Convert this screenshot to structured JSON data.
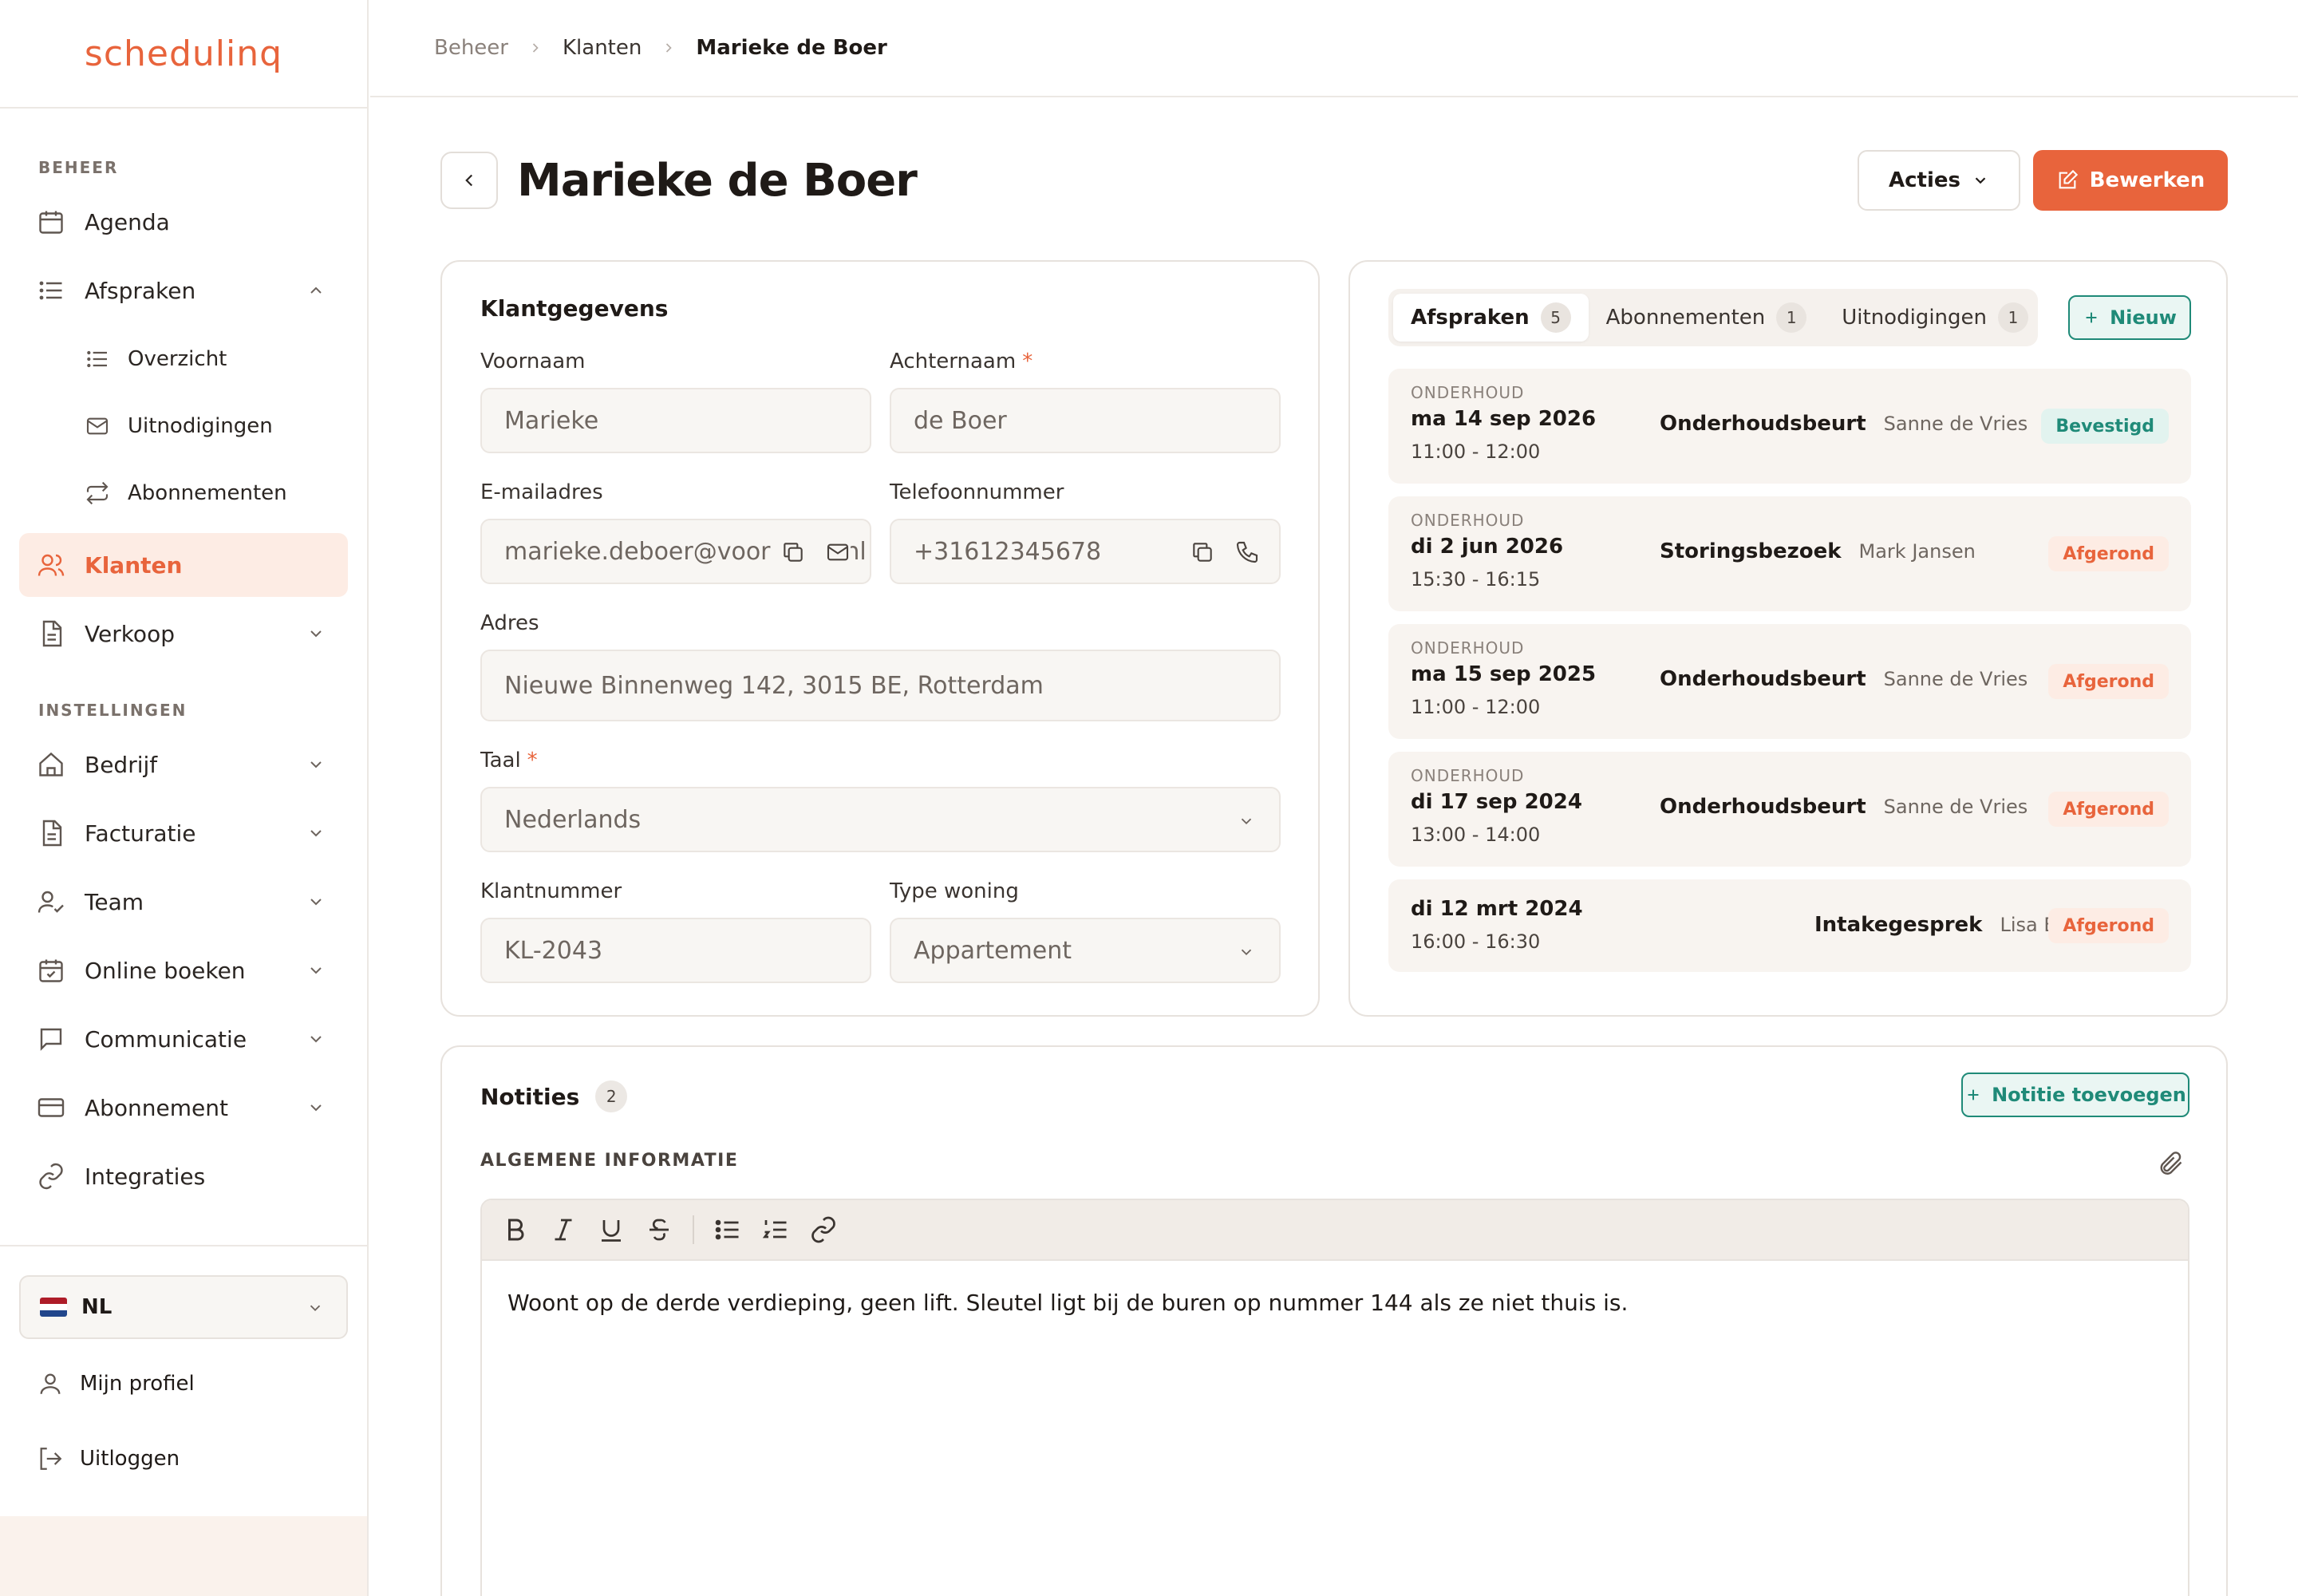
{
  "app": {
    "logo": "schedulinq",
    "brand_color": "#e8643c",
    "accent_teal": "#1f8a78"
  },
  "sidebar": {
    "section_beheer": "BEHEER",
    "items_beheer": [
      {
        "label": "Agenda",
        "icon": "calendar-icon"
      },
      {
        "label": "Afspraken",
        "icon": "list-icon",
        "expanded": true
      },
      {
        "label": "Klanten",
        "icon": "users-icon",
        "active": true
      },
      {
        "label": "Verkoop",
        "icon": "document-icon"
      }
    ],
    "sub_afspraken": [
      {
        "label": "Overzicht",
        "icon": "list-icon"
      },
      {
        "label": "Uitnodigingen",
        "icon": "mail-icon"
      },
      {
        "label": "Abonnementen",
        "icon": "repeat-icon"
      }
    ],
    "section_instellingen": "INSTELLINGEN",
    "items_instellingen": [
      {
        "label": "Bedrijf",
        "icon": "home-icon"
      },
      {
        "label": "Facturatie",
        "icon": "document-icon"
      },
      {
        "label": "Team",
        "icon": "user-check-icon"
      },
      {
        "label": "Online boeken",
        "icon": "calendar-check-icon"
      },
      {
        "label": "Communicatie",
        "icon": "message-icon"
      },
      {
        "label": "Abonnement",
        "icon": "credit-card-icon"
      },
      {
        "label": "Integraties",
        "icon": "link-icon"
      }
    ],
    "language": "NL",
    "profile": "Mijn profiel",
    "logout": "Uitloggen"
  },
  "breadcrumb": [
    "Beheer",
    "Klanten",
    "Marieke de Boer"
  ],
  "header": {
    "title": "Marieke de Boer",
    "actions_label": "Acties",
    "edit_label": "Bewerken"
  },
  "klant": {
    "title": "Klantgegevens",
    "voornaam_label": "Voornaam",
    "voornaam": "Marieke",
    "achternaam_label": "Achternaam",
    "achternaam": "de Boer",
    "email_label": "E-mailadres",
    "email": "marieke.deboer@voorbeeld.nl",
    "telefoon_label": "Telefoonnummer",
    "telefoon": "+31612345678",
    "adres_label": "Adres",
    "adres": "Nieuwe Binnenweg 142, 3015 BE, Rotterdam",
    "taal_label": "Taal",
    "taal": "Nederlands",
    "klantnummer_label": "Klantnummer",
    "klantnummer": "KL-2043",
    "woning_label": "Type woning",
    "woning": "Appartement",
    "required_mark": "*"
  },
  "tabs": [
    {
      "label": "Afspraken",
      "count": "5",
      "active": true
    },
    {
      "label": "Abonnementen",
      "count": "1"
    },
    {
      "label": "Uitnodigingen",
      "count": "1"
    }
  ],
  "new_label": "Nieuw",
  "appointments": [
    {
      "category": "ONDERHOUD",
      "date": "ma 14 sep 2026",
      "time": "11:00 - 12:00",
      "service": "Onderhoudsbeurt",
      "tech": "Sanne de Vries",
      "status": "Bevestigd",
      "status_color": "green"
    },
    {
      "category": "ONDERHOUD",
      "date": "di 2 jun 2026",
      "time": "15:30 - 16:15",
      "service": "Storingsbezoek",
      "tech": "Mark Jansen",
      "status": "Afgerond",
      "status_color": "orange"
    },
    {
      "category": "ONDERHOUD",
      "date": "ma 15 sep 2025",
      "time": "11:00 - 12:00",
      "service": "Onderhoudsbeurt",
      "tech": "Sanne de Vries",
      "status": "Afgerond",
      "status_color": "orange"
    },
    {
      "category": "ONDERHOUD",
      "date": "di 17 sep 2024",
      "time": "13:00 - 14:00",
      "service": "Onderhoudsbeurt",
      "tech": "Sanne de Vries",
      "status": "Afgerond",
      "status_color": "orange"
    },
    {
      "category": "",
      "date": "di 12 mrt 2024",
      "time": "16:00 - 16:30",
      "service": "Intakegesprek",
      "tech": "Lisa Bakker",
      "status": "Afgerond",
      "status_color": "orange"
    }
  ],
  "notes": {
    "title": "Notities",
    "count": "2",
    "add_label": "Notitie toevoegen",
    "section": "ALGEMENE INFORMATIE",
    "body": "Woont op de derde verdieping, geen lift. Sleutel ligt bij de buren op nummer 144 als ze niet thuis is."
  }
}
